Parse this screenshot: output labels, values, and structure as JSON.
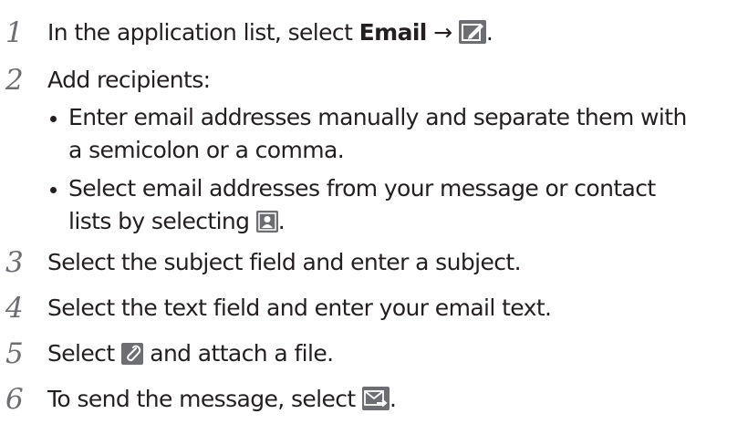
{
  "steps": [
    {
      "num": "1",
      "prefix": "In the application list, select ",
      "bold": "Email",
      "arrow": " → ",
      "icon": "compose-icon",
      "suffix": "."
    },
    {
      "num": "2",
      "text": "Add recipients:"
    },
    {
      "num": "3",
      "text": "Select the subject field and enter a subject."
    },
    {
      "num": "4",
      "text": "Select the text field and enter your email text."
    },
    {
      "num": "5",
      "prefix": "Select ",
      "icon": "paperclip-icon",
      "suffix": " and attach a file."
    },
    {
      "num": "6",
      "prefix": "To send the message, select ",
      "icon": "send-email-icon",
      "suffix": "."
    }
  ],
  "bullets": [
    {
      "line1": "Enter email addresses manually and separate them with",
      "line2": "a semicolon or a comma."
    },
    {
      "line1": "Select email addresses from your message or contact",
      "line2_prefix": "lists by selecting ",
      "icon": "contact-icon",
      "line2_suffix": "."
    }
  ],
  "colors": {
    "text": "#231f20",
    "number": "#6d6e71",
    "icon_bg": "#6d6e71"
  }
}
